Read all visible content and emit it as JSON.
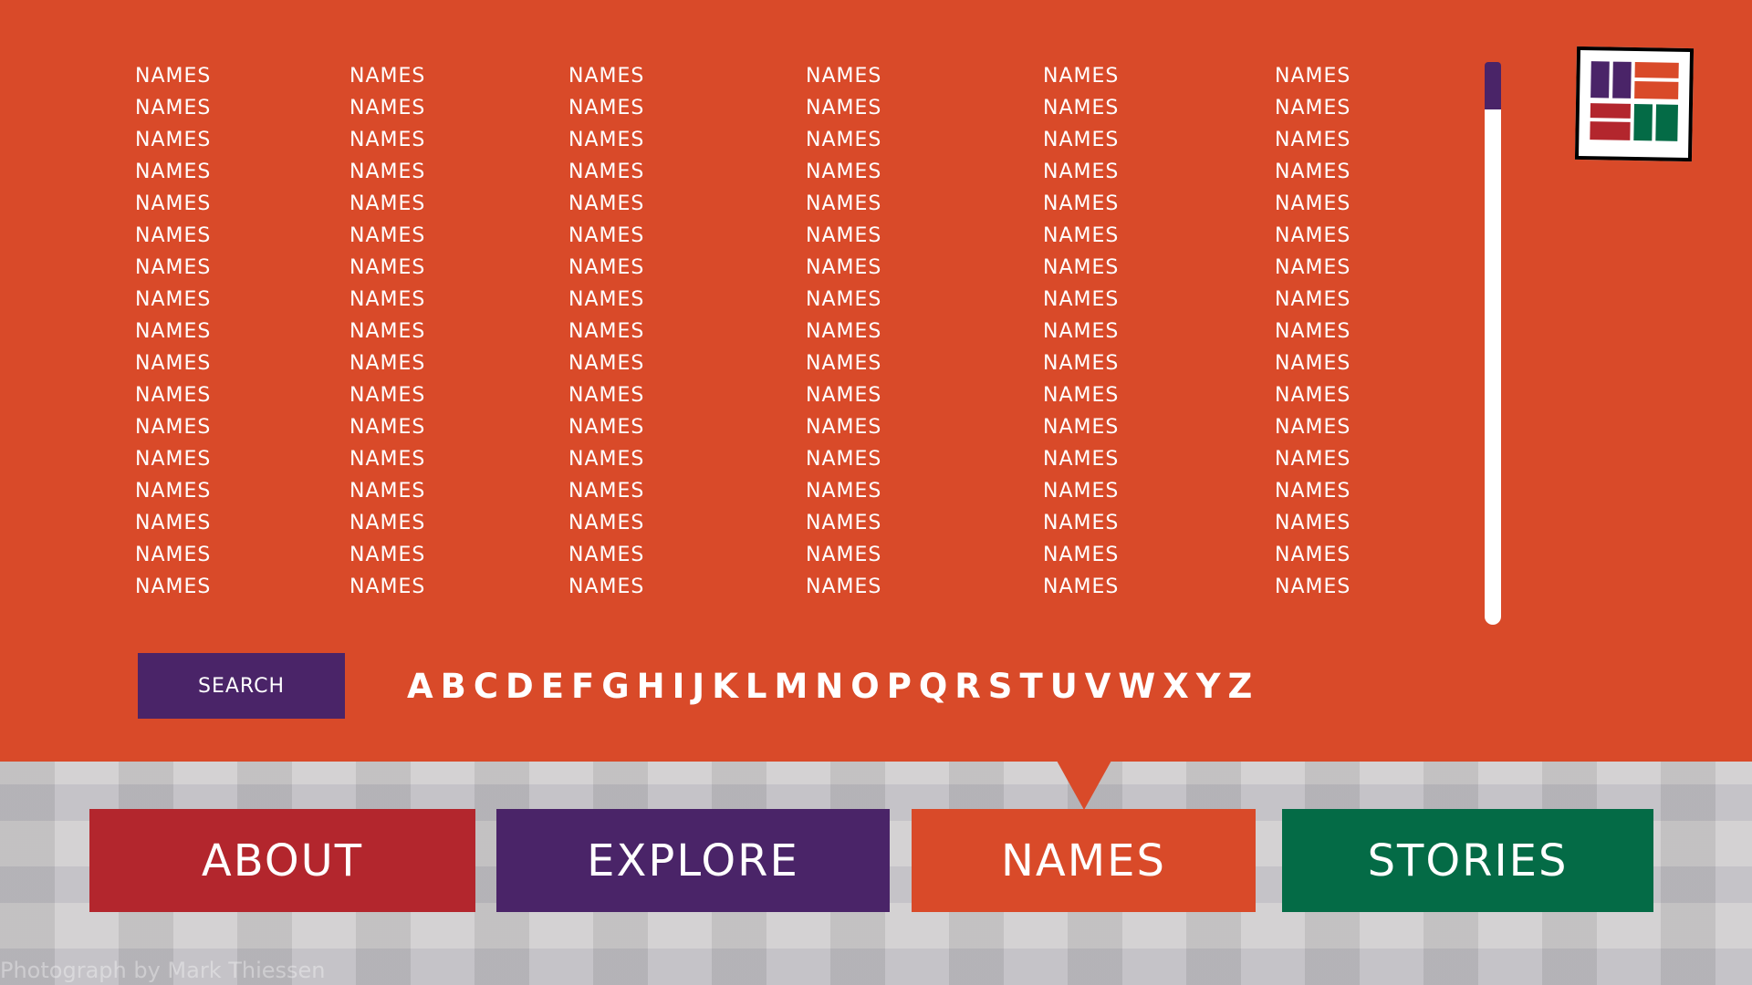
{
  "theme": {
    "orange": "#d94a29",
    "purple": "#4a2468",
    "red": "#b3262d",
    "green": "#046b46",
    "white": "#ffffff"
  },
  "names_list": {
    "columns": 6,
    "rows": 17,
    "entry_label": "NAMES"
  },
  "search": {
    "label": "SEARCH"
  },
  "alphabet": [
    "A",
    "B",
    "C",
    "D",
    "E",
    "F",
    "G",
    "H",
    "I",
    "J",
    "K",
    "L",
    "M",
    "N",
    "O",
    "P",
    "Q",
    "R",
    "S",
    "T",
    "U",
    "V",
    "W",
    "X",
    "Y",
    "Z"
  ],
  "nav": {
    "about": "ABOUT",
    "explore": "EXPLORE",
    "names": "NAMES",
    "stories": "STORIES"
  },
  "logo": {
    "icon": "quilt-logo-icon"
  },
  "credit": "Photograph by Mark Thiessen"
}
